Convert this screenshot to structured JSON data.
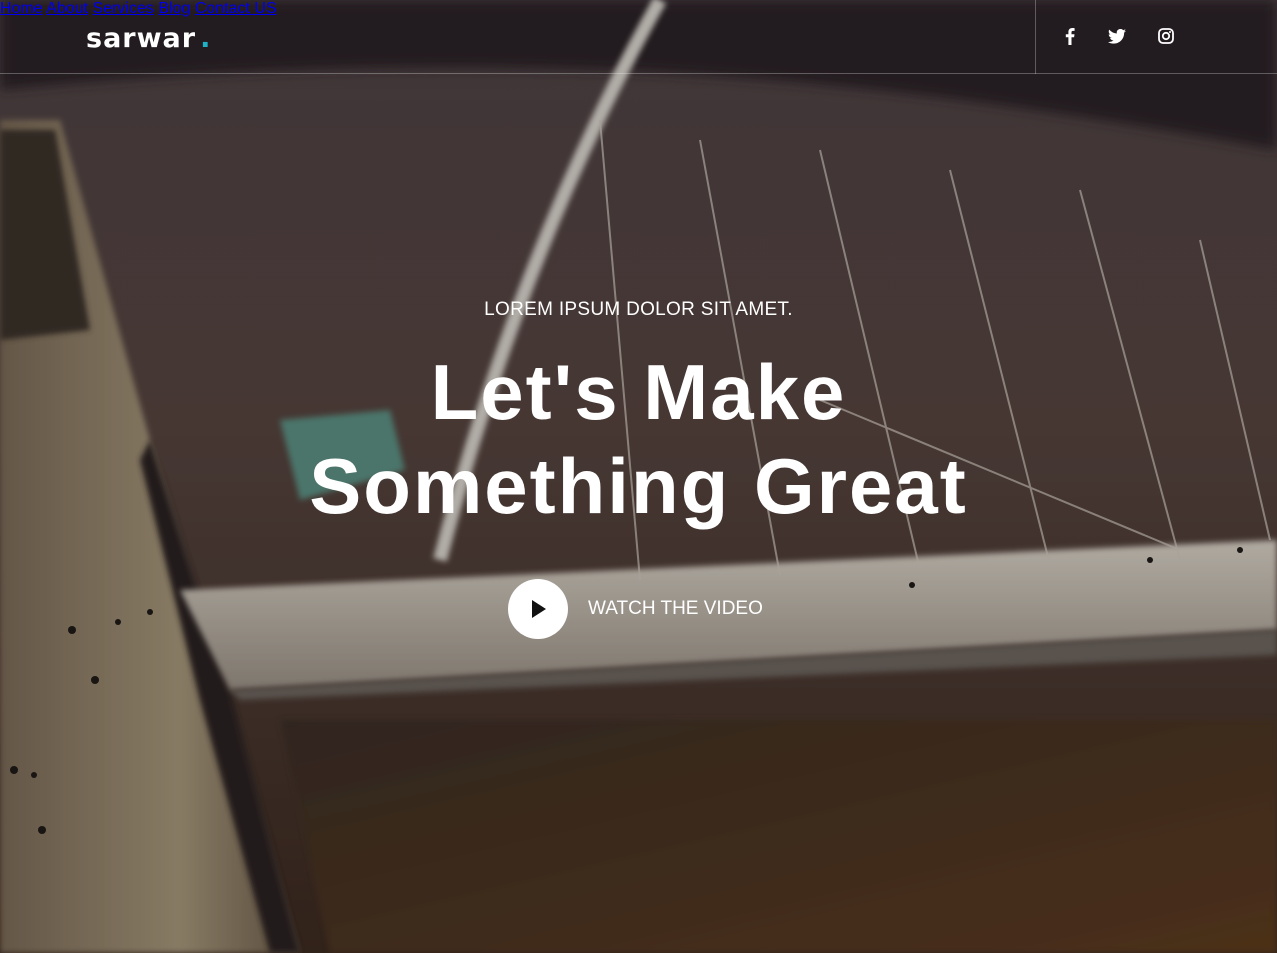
{
  "brand": {
    "name": "sarwar",
    "dot": ".",
    "accent_color": "#1fb2c6"
  },
  "nav": {
    "items": [
      {
        "label": "Home"
      },
      {
        "label": "About"
      },
      {
        "label": "Services"
      },
      {
        "label": "Blog"
      },
      {
        "label": "Contact US"
      }
    ]
  },
  "social": [
    {
      "icon": "facebook-icon"
    },
    {
      "icon": "twitter-icon"
    },
    {
      "icon": "instagram-icon"
    }
  ],
  "hero": {
    "eyebrow": "LOREM IPSUM DOLOR SIT AMET.",
    "headline_line1": "Let's Make",
    "headline_line2": "Something Great",
    "video_cta": "WATCH THE VIDEO"
  }
}
